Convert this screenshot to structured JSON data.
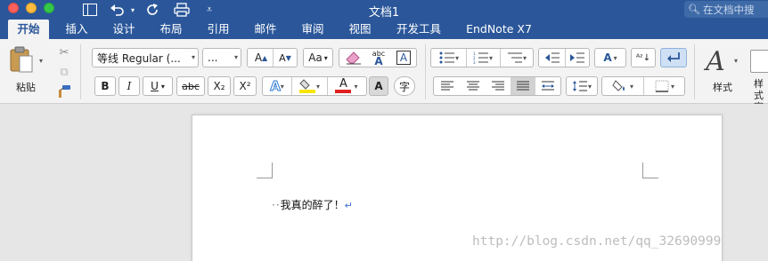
{
  "window": {
    "title": "文档1",
    "search_placeholder": "在文档中搜"
  },
  "tabs": [
    {
      "label": "开始",
      "active": true
    },
    {
      "label": "插入"
    },
    {
      "label": "设计"
    },
    {
      "label": "布局"
    },
    {
      "label": "引用"
    },
    {
      "label": "邮件"
    },
    {
      "label": "审阅"
    },
    {
      "label": "视图"
    },
    {
      "label": "开发工具"
    },
    {
      "label": "EndNote X7"
    }
  ],
  "ribbon": {
    "paste_label": "粘贴",
    "font_name": "等线 Regular (...",
    "font_size": "...",
    "bold": "B",
    "italic": "I",
    "underline": "U",
    "strike": "abc",
    "subscript": "X₂",
    "superscript": "X²",
    "styles_label": "样式",
    "styles_pane_label": "样式窗格"
  },
  "document": {
    "body_text": "我真的醉了！",
    "leading_marks": "··",
    "paragraph_mark": "↵"
  },
  "watermark": "http://blog.csdn.net/qq_32690999",
  "colors": {
    "ribbon_blue": "#2b579a",
    "highlight_yellow": "#f7e400",
    "font_color_red": "#e02020"
  }
}
